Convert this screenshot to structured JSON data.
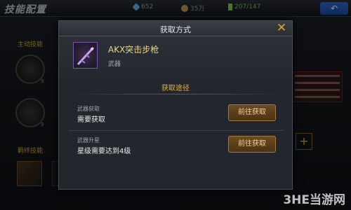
{
  "screen": {
    "title": "技能配置",
    "resources": {
      "gems": "652",
      "gold": "35万",
      "energy": "207/147"
    },
    "left_labels": {
      "active_skills": "主动技能",
      "team_skills": "羁绊技能"
    },
    "slot_counts": [
      "9",
      "9"
    ]
  },
  "modal": {
    "title": "获取方式",
    "item": {
      "name": "AKX突击步枪",
      "type": "武器"
    },
    "section_title": "获取途径",
    "methods": [
      {
        "label": "武器获取",
        "desc": "需要获取",
        "button": "前往获取"
      },
      {
        "label": "武器升星",
        "desc": "星级需要达到4级",
        "button": "前往获取"
      }
    ]
  },
  "watermark": "3HE当游网",
  "colors": {
    "accent_gold": "#e2b13c",
    "close_orange": "#f19a2a",
    "item_name": "#ecd48a"
  }
}
